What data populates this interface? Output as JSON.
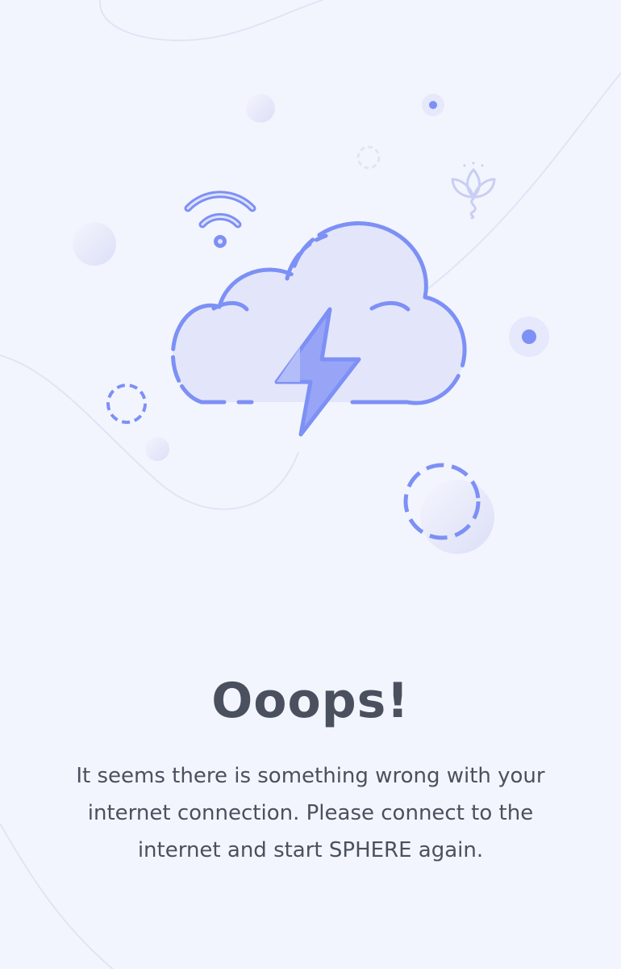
{
  "error_screen": {
    "title": "Ooops!",
    "message": "It seems there is something wrong with your internet connection. Please connect to the internet and start SPHERE again."
  },
  "illustration": {
    "main_icon": "thunder-cloud-icon",
    "signal_icon": "wifi-icon",
    "decoration_icon": "lotus-icon"
  },
  "colors": {
    "background": "#f3f5fe",
    "accent": "#7d90f5",
    "accent_fill": "#e3e6fb",
    "text": "#4a505e"
  }
}
